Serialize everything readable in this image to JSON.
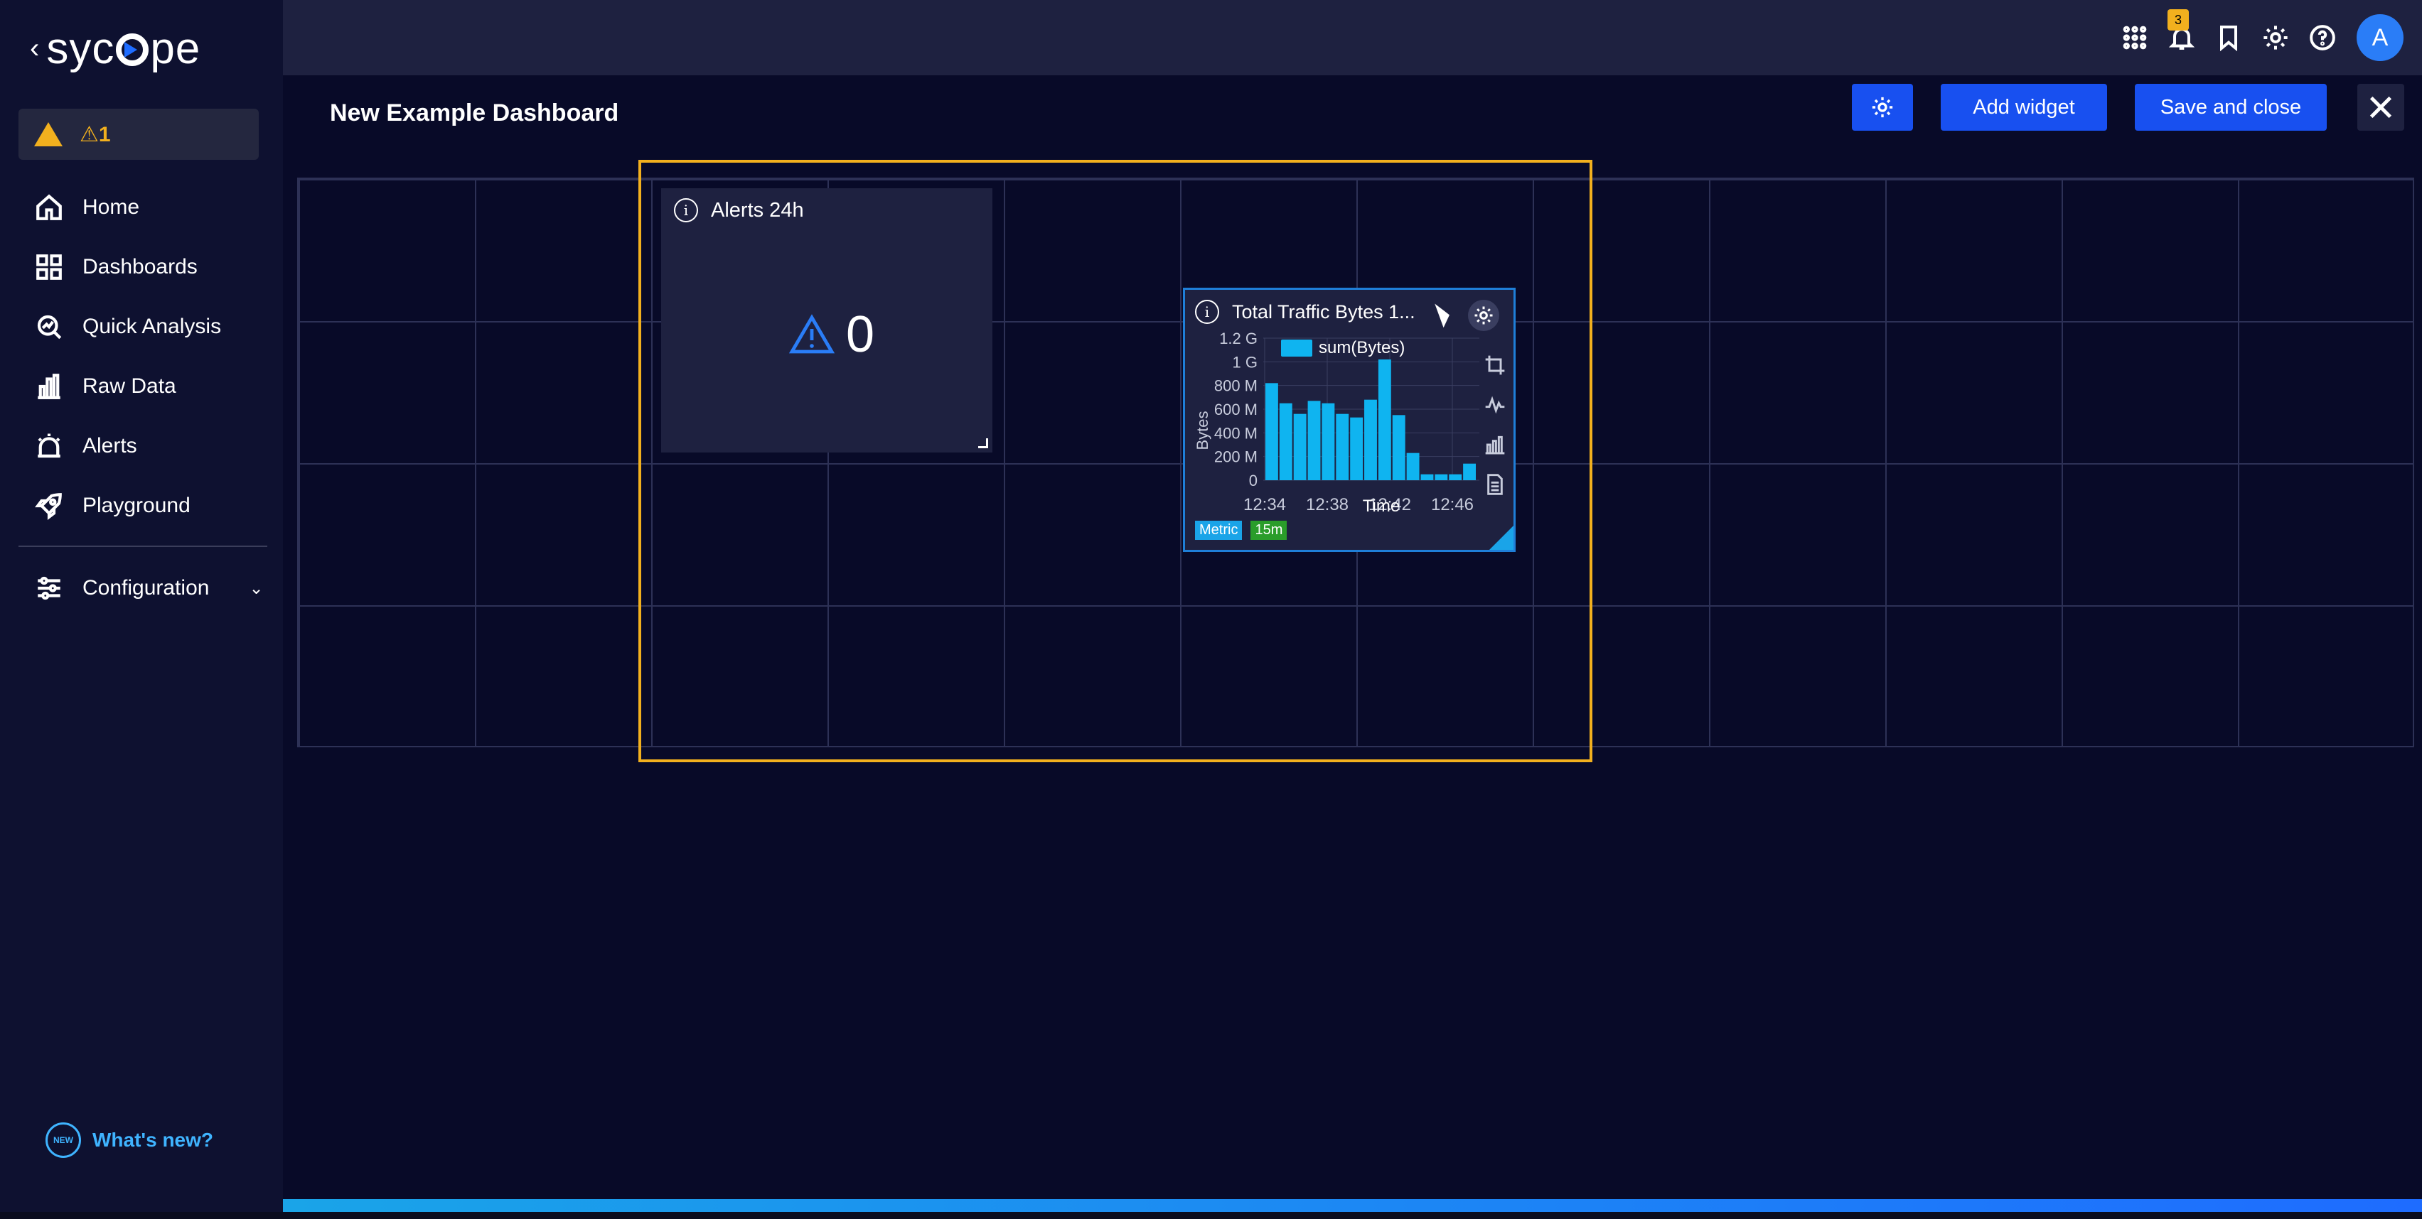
{
  "app": {
    "logo_text": "sycope",
    "back_icon": "chevron-left-icon"
  },
  "sidebar": {
    "alert_count": "⚠1",
    "items": [
      {
        "label": "Home",
        "icon": "home-icon"
      },
      {
        "label": "Dashboards",
        "icon": "dashboards-icon"
      },
      {
        "label": "Quick Analysis",
        "icon": "quick-analysis-icon"
      },
      {
        "label": "Raw Data",
        "icon": "raw-data-icon"
      },
      {
        "label": "Alerts",
        "icon": "alarm-icon"
      },
      {
        "label": "Playground",
        "icon": "rocket-icon"
      }
    ],
    "configuration": {
      "label": "Configuration",
      "icon": "sliders-icon"
    },
    "whats_new": {
      "label": "What's new?",
      "badge": "NEW"
    }
  },
  "topbar": {
    "notifications_count": "3",
    "avatar_letter": "A"
  },
  "header": {
    "title": "New Example Dashboard",
    "add_widget_label": "Add widget",
    "save_close_label": "Save and close"
  },
  "widgets": {
    "alerts": {
      "title": "Alerts 24h",
      "value": "0"
    },
    "traffic": {
      "title": "Total Traffic Bytes 1...",
      "tag_metric": "Metric",
      "tag_time": "15m"
    }
  },
  "chart_data": {
    "type": "bar",
    "title": "Total Traffic Bytes 1...",
    "xlabel": "Time",
    "ylabel": "Bytes",
    "legend": [
      "sum(Bytes)"
    ],
    "x_ticks": [
      "12:34",
      "12:38",
      "12:42",
      "12:46"
    ],
    "y_ticks": [
      "0",
      "200 M",
      "400 M",
      "600 M",
      "800 M",
      "1 G",
      "1.2 G"
    ],
    "ylim": [
      0,
      1200000000
    ],
    "series": [
      {
        "name": "sum(Bytes)",
        "color": "#0fb4f0",
        "values": [
          820000000,
          650000000,
          560000000,
          670000000,
          650000000,
          560000000,
          530000000,
          680000000,
          1020000000,
          550000000,
          230000000,
          50000000,
          50000000,
          50000000,
          140000000
        ]
      }
    ]
  },
  "colors": {
    "accent": "#1850f0",
    "warning": "#f2b01e",
    "background": "#080a28",
    "sidebar": "#0e1130",
    "bar": "#0fb4f0"
  }
}
